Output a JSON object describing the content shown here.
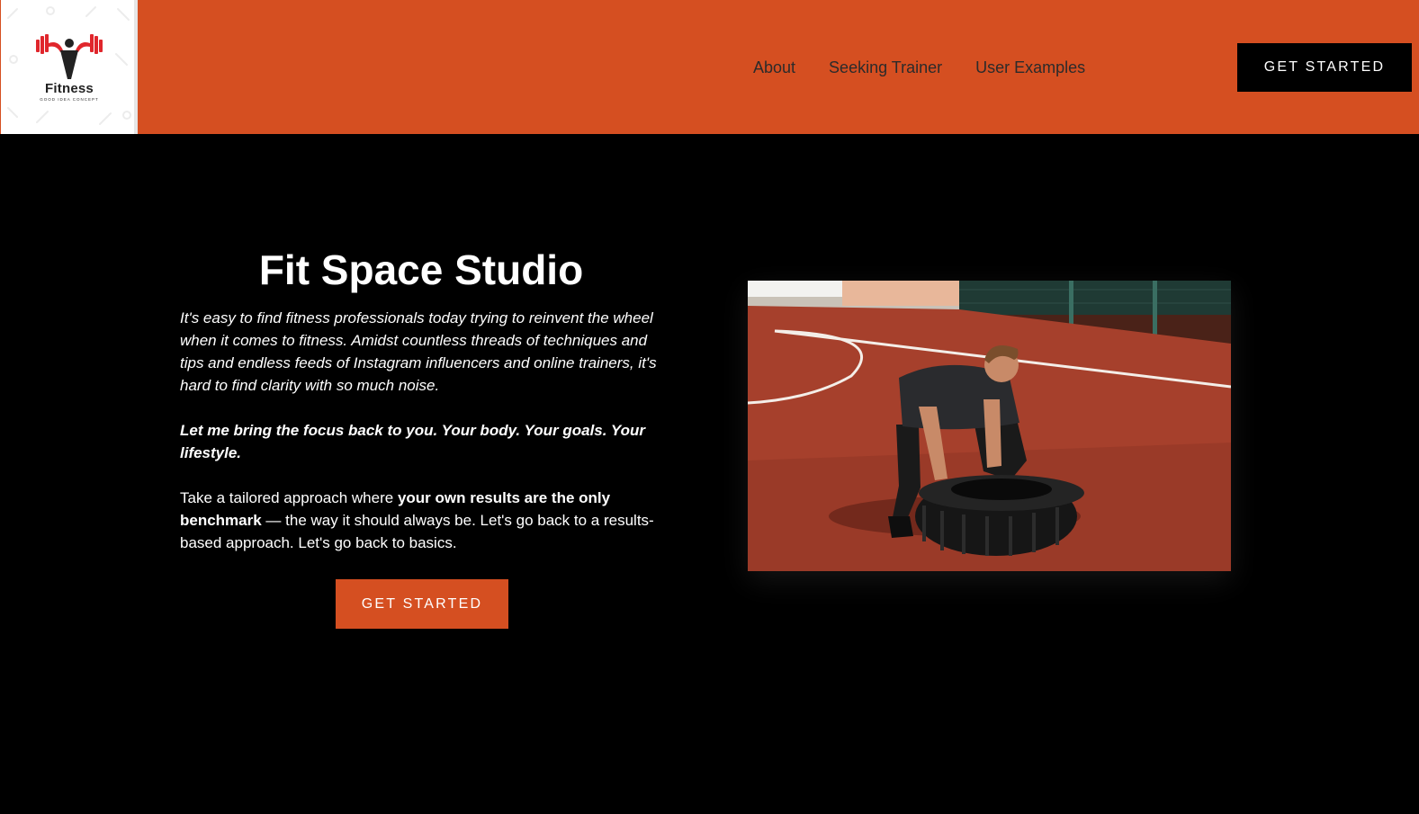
{
  "header": {
    "logo": {
      "wordmark": "Fitness",
      "tagline": "GOOD IDEA CONCEPT"
    },
    "nav": [
      {
        "label": "About"
      },
      {
        "label": "Seeking Trainer"
      },
      {
        "label": "User Examples"
      }
    ],
    "cta_label": "GET STARTED"
  },
  "hero": {
    "title": "Fit Space Studio",
    "intro": "It's easy to find fitness professionals today trying to reinvent the wheel when it comes to fitness. Amidst countless threads of techniques and tips and endless feeds of Instagram influencers and online trainers, it's hard to find clarity with so much noise.",
    "focus": "Let me bring the focus back to you. Your body. Your goals. Your lifestyle.",
    "approach_lead": "Take a tailored approach where ",
    "approach_bold": "your own results are the only benchmark",
    "approach_tail": " — the way it should always be. Let's go back to a results-based approach. Let's go back to basics.",
    "cta_label": "GET STARTED",
    "photo_icon": "man-flipping-tire-photo"
  },
  "colors": {
    "brand_orange": "#d54f21",
    "background": "#000000",
    "text_light": "#ffffff",
    "nav_text": "#2b2b2b",
    "logo_red": "#e0262c"
  }
}
